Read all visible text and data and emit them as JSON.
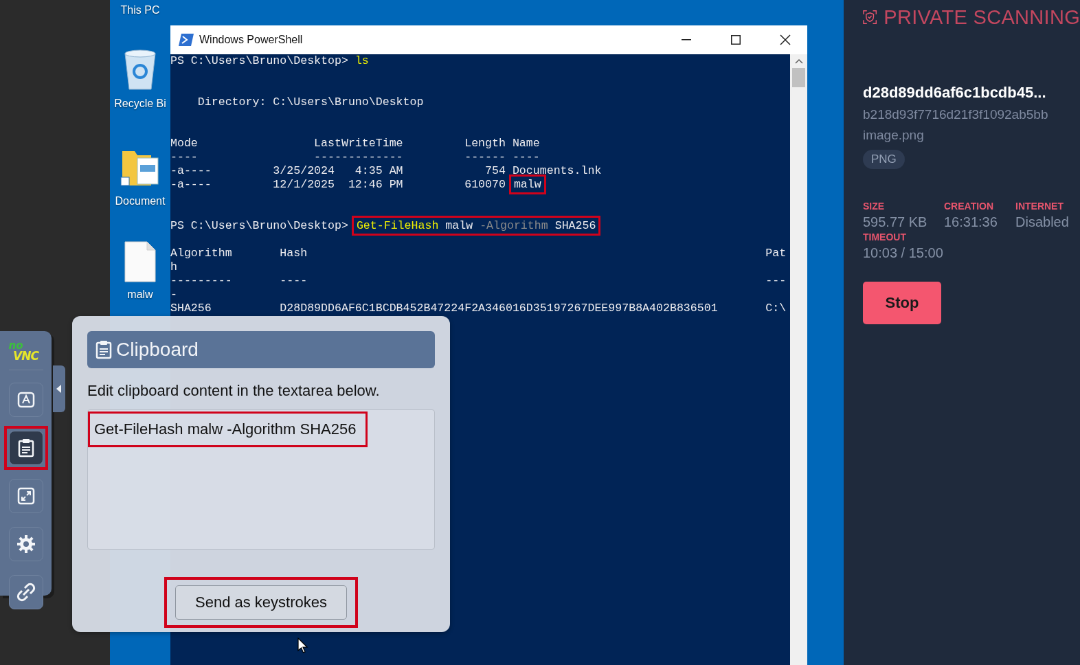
{
  "desktop": {
    "icons": [
      {
        "kind": "computer",
        "label": "This PC"
      },
      {
        "kind": "recycle-bin",
        "label": "Recycle Bi"
      },
      {
        "kind": "folder",
        "label": "Document"
      },
      {
        "kind": "file",
        "label": "malw"
      }
    ]
  },
  "powershell": {
    "title": "Windows PowerShell",
    "lines": [
      {
        "kind": "text",
        "segments": [
          {
            "text": "PS C:\\Users\\Bruno\\Desktop> ",
            "kind": "plain"
          },
          {
            "text": "ls",
            "kind": "command"
          }
        ]
      },
      {
        "kind": "blank"
      },
      {
        "kind": "blank"
      },
      {
        "kind": "text",
        "segments": [
          {
            "text": "    Directory: C:\\Users\\Bruno\\Desktop",
            "kind": "plain"
          }
        ]
      },
      {
        "kind": "blank"
      },
      {
        "kind": "blank"
      },
      {
        "kind": "text",
        "segments": [
          {
            "text": "Mode                 LastWriteTime         Length Name",
            "kind": "plain"
          }
        ]
      },
      {
        "kind": "text",
        "segments": [
          {
            "text": "----                 -------------         ------ ----",
            "kind": "plain"
          }
        ]
      },
      {
        "kind": "text",
        "segments": [
          {
            "text": "-a----         3/25/2024   4:35 AM            754 Documents.lnk",
            "kind": "plain"
          }
        ]
      },
      {
        "kind": "text",
        "segments": [
          {
            "text": "-a----         12/1/2025  12:46 PM         610070 ",
            "kind": "plain"
          },
          {
            "kind": "boxed",
            "segments": [
              {
                "text": "malw",
                "kind": "plain"
              }
            ]
          }
        ]
      },
      {
        "kind": "blank"
      },
      {
        "kind": "blank"
      },
      {
        "kind": "text",
        "segments": [
          {
            "text": "PS C:\\Users\\Bruno\\Desktop> ",
            "kind": "plain"
          },
          {
            "kind": "boxed",
            "segments": [
              {
                "text": "Get-FileHash",
                "kind": "command"
              },
              {
                "text": " malw ",
                "kind": "plain"
              },
              {
                "text": "-Algorithm",
                "kind": "parameter"
              },
              {
                "text": " SHA256",
                "kind": "plain"
              }
            ]
          }
        ]
      },
      {
        "kind": "blank"
      },
      {
        "kind": "text",
        "segments": [
          {
            "text": "Algorithm       Hash                                                                   Pat",
            "kind": "plain"
          }
        ]
      },
      {
        "kind": "text",
        "segments": [
          {
            "text": "h",
            "kind": "plain"
          }
        ]
      },
      {
        "kind": "text",
        "segments": [
          {
            "text": "---------       ----                                                                   ---",
            "kind": "plain"
          }
        ]
      },
      {
        "kind": "text",
        "segments": [
          {
            "text": "-",
            "kind": "plain"
          }
        ]
      },
      {
        "kind": "text",
        "segments": [
          {
            "text": "SHA256          D28D89DD6AF6C1BCDB452B47224F2A346016D35197267DEE997B8A402B836501       C:\\",
            "kind": "plain"
          }
        ]
      }
    ]
  },
  "novnc_bar": {
    "logo_top": "no",
    "logo_bottom": "VNC",
    "buttons": [
      {
        "kind": "keyboard",
        "selected": false,
        "outlined": false
      },
      {
        "kind": "clipboard",
        "selected": true,
        "outlined": true
      },
      {
        "kind": "fullscreen",
        "selected": false,
        "outlined": false
      },
      {
        "kind": "settings",
        "selected": false,
        "outlined": false
      },
      {
        "kind": "disconnect",
        "selected": false,
        "outlined": false
      }
    ]
  },
  "clipboard_panel": {
    "title": "Clipboard",
    "instructions": "Edit clipboard content in the textarea below.",
    "value": "Get-FileHash malw -Algorithm SHA256",
    "value_outlined": true,
    "button": "Send as keystrokes",
    "button_outlined": true
  },
  "scan_panel": {
    "brand": "PRIVATE SCANNING",
    "hash": "d28d89dd6af6c1bcdb45...",
    "hash_full": "b218d93f7716d21f3f1092ab5bb",
    "filename": "image.png",
    "file_type": "PNG",
    "stats": [
      {
        "label": "SIZE",
        "value": "595.77 KB"
      },
      {
        "label": "CREATION",
        "value": "16:31:36"
      },
      {
        "label": "INTERNET",
        "value": "Disabled"
      },
      {
        "label": "TIMEOUT",
        "value": "10:03 / 15:00"
      }
    ],
    "stop_button": "Stop"
  }
}
